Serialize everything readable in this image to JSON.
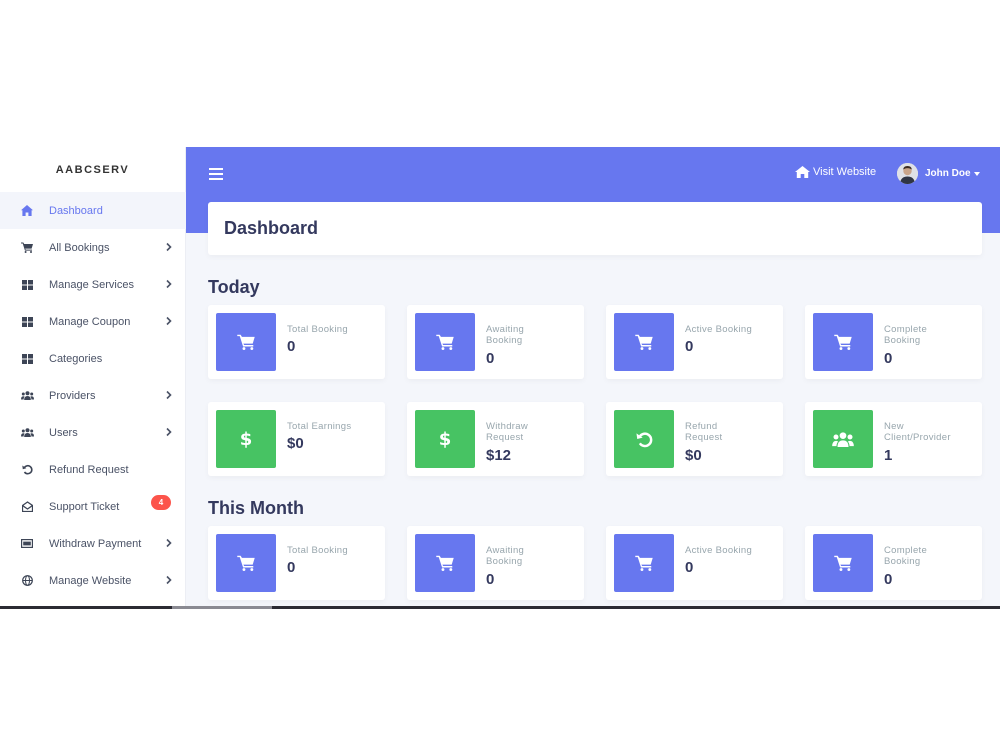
{
  "brand": "AABCSERV",
  "sidebar": {
    "items": [
      {
        "label": "Dashboard"
      },
      {
        "label": "All Bookings"
      },
      {
        "label": "Manage Services"
      },
      {
        "label": "Manage Coupon"
      },
      {
        "label": "Categories"
      },
      {
        "label": "Providers"
      },
      {
        "label": "Users"
      },
      {
        "label": "Refund Request"
      },
      {
        "label": "Support Ticket",
        "badge": "4"
      },
      {
        "label": "Withdraw Payment"
      },
      {
        "label": "Manage Website"
      }
    ]
  },
  "header": {
    "visit_label": "Visit Website",
    "user_name": "John Doe"
  },
  "page": {
    "title": "Dashboard"
  },
  "today": {
    "title": "Today",
    "cards": [
      {
        "label": "Total Booking",
        "value": "0"
      },
      {
        "label": "Awaiting Booking",
        "value": "0"
      },
      {
        "label": "Active Booking",
        "value": "0"
      },
      {
        "label": "Complete Booking",
        "value": "0"
      },
      {
        "label": "Total Earnings",
        "value": "$0"
      },
      {
        "label": "Withdraw Request",
        "value": "$12"
      },
      {
        "label": "Refund Request",
        "value": "$0"
      },
      {
        "label": "New Client/Provider",
        "value": "1"
      }
    ]
  },
  "month": {
    "title": "This Month",
    "cards": [
      {
        "label": "Total Booking",
        "value": "0"
      },
      {
        "label": "Awaiting Booking",
        "value": "0"
      },
      {
        "label": "Active Booking",
        "value": "0"
      },
      {
        "label": "Complete Booking",
        "value": "0"
      }
    ]
  },
  "colors": {
    "primary": "#6777ef",
    "success": "#47c363",
    "danger": "#fc544b",
    "heading": "#34395e"
  },
  "icons": {
    "dollar_symbol": "$"
  }
}
